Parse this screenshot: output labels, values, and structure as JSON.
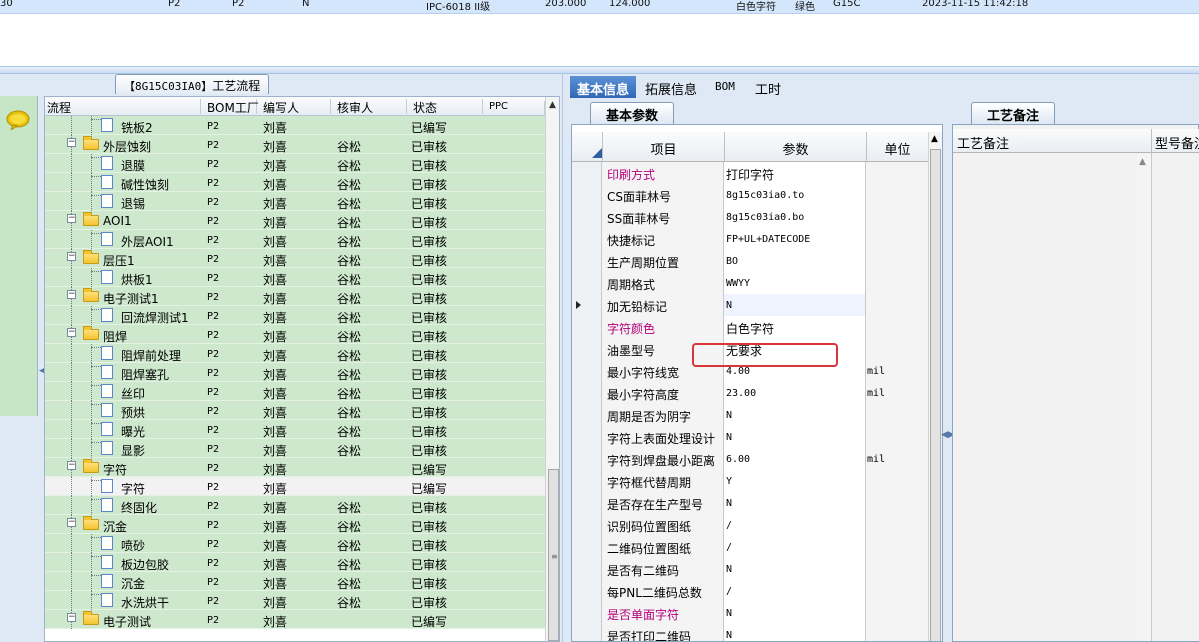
{
  "top_row": [
    "30",
    "P2",
    "P2",
    "N",
    "IPC-6018 II级",
    "203.000",
    "124.000",
    "白色字符",
    "绿色",
    "G15C",
    "2023-11-15 11:42:18"
  ],
  "left_panel": {
    "tab_code": "【8G15C03IA0】",
    "tab_label": "工艺流程",
    "columns": [
      "流程",
      "BOM工厂",
      "编写人",
      "核审人",
      "状态",
      "PPC"
    ]
  },
  "tree_rows": [
    {
      "level": 2,
      "type": "doc",
      "name": "铣板2",
      "bom": "P2",
      "writer": "刘喜",
      "reviewer": "",
      "status": "已编写"
    },
    {
      "level": 1,
      "type": "folder",
      "name": "外层蚀刻",
      "bom": "P2",
      "writer": "刘喜",
      "reviewer": "谷松",
      "status": "已审核"
    },
    {
      "level": 2,
      "type": "doc",
      "name": "退膜",
      "bom": "P2",
      "writer": "刘喜",
      "reviewer": "谷松",
      "status": "已审核"
    },
    {
      "level": 2,
      "type": "doc",
      "name": "碱性蚀刻",
      "bom": "P2",
      "writer": "刘喜",
      "reviewer": "谷松",
      "status": "已审核"
    },
    {
      "level": 2,
      "type": "doc",
      "name": "退锡",
      "bom": "P2",
      "writer": "刘喜",
      "reviewer": "谷松",
      "status": "已审核"
    },
    {
      "level": 1,
      "type": "folder",
      "name": "AOI1",
      "bom": "P2",
      "writer": "刘喜",
      "reviewer": "谷松",
      "status": "已审核"
    },
    {
      "level": 2,
      "type": "doc",
      "name": "外层AOI1",
      "bom": "P2",
      "writer": "刘喜",
      "reviewer": "谷松",
      "status": "已审核"
    },
    {
      "level": 1,
      "type": "folder",
      "name": "层压1",
      "bom": "P2",
      "writer": "刘喜",
      "reviewer": "谷松",
      "status": "已审核"
    },
    {
      "level": 2,
      "type": "doc",
      "name": "烘板1",
      "bom": "P2",
      "writer": "刘喜",
      "reviewer": "谷松",
      "status": "已审核"
    },
    {
      "level": 1,
      "type": "folder",
      "name": "电子测试1",
      "bom": "P2",
      "writer": "刘喜",
      "reviewer": "谷松",
      "status": "已审核"
    },
    {
      "level": 2,
      "type": "doc",
      "name": "回流焊测试1",
      "bom": "P2",
      "writer": "刘喜",
      "reviewer": "谷松",
      "status": "已审核"
    },
    {
      "level": 1,
      "type": "folder",
      "name": "阻焊",
      "bom": "P2",
      "writer": "刘喜",
      "reviewer": "谷松",
      "status": "已审核"
    },
    {
      "level": 2,
      "type": "doc",
      "name": "阻焊前处理",
      "bom": "P2",
      "writer": "刘喜",
      "reviewer": "谷松",
      "status": "已审核"
    },
    {
      "level": 2,
      "type": "doc",
      "name": "阻焊塞孔",
      "bom": "P2",
      "writer": "刘喜",
      "reviewer": "谷松",
      "status": "已审核"
    },
    {
      "level": 2,
      "type": "doc",
      "name": "丝印",
      "bom": "P2",
      "writer": "刘喜",
      "reviewer": "谷松",
      "status": "已审核"
    },
    {
      "level": 2,
      "type": "doc",
      "name": "预烘",
      "bom": "P2",
      "writer": "刘喜",
      "reviewer": "谷松",
      "status": "已审核"
    },
    {
      "level": 2,
      "type": "doc",
      "name": "曝光",
      "bom": "P2",
      "writer": "刘喜",
      "reviewer": "谷松",
      "status": "已审核"
    },
    {
      "level": 2,
      "type": "doc",
      "name": "显影",
      "bom": "P2",
      "writer": "刘喜",
      "reviewer": "谷松",
      "status": "已审核"
    },
    {
      "level": 1,
      "type": "folder",
      "name": "字符",
      "bom": "P2",
      "writer": "刘喜",
      "reviewer": "",
      "status": "已编写"
    },
    {
      "level": 2,
      "type": "doc",
      "name": "字符",
      "bom": "P2",
      "writer": "刘喜",
      "reviewer": "",
      "status": "已编写",
      "selected": true
    },
    {
      "level": 2,
      "type": "doc",
      "name": "终固化",
      "bom": "P2",
      "writer": "刘喜",
      "reviewer": "谷松",
      "status": "已审核"
    },
    {
      "level": 1,
      "type": "folder",
      "name": "沉金",
      "bom": "P2",
      "writer": "刘喜",
      "reviewer": "谷松",
      "status": "已审核"
    },
    {
      "level": 2,
      "type": "doc",
      "name": "喷砂",
      "bom": "P2",
      "writer": "刘喜",
      "reviewer": "谷松",
      "status": "已审核"
    },
    {
      "level": 2,
      "type": "doc",
      "name": "板边包胶",
      "bom": "P2",
      "writer": "刘喜",
      "reviewer": "谷松",
      "status": "已审核"
    },
    {
      "level": 2,
      "type": "doc",
      "name": "沉金",
      "bom": "P2",
      "writer": "刘喜",
      "reviewer": "谷松",
      "status": "已审核"
    },
    {
      "level": 2,
      "type": "doc",
      "name": "水洗烘干",
      "bom": "P2",
      "writer": "刘喜",
      "reviewer": "谷松",
      "status": "已审核"
    },
    {
      "level": 1,
      "type": "folder",
      "name": "电子测试",
      "bom": "P2",
      "writer": "刘喜",
      "reviewer": "",
      "status": "已编写"
    }
  ],
  "main_tabs": [
    {
      "label": "基本信息",
      "active": true
    },
    {
      "label": "拓展信息",
      "active": false
    },
    {
      "label": "BOM",
      "active": false
    },
    {
      "label": "工时",
      "active": false
    }
  ],
  "param_panel": {
    "tab_label": "基本参数",
    "columns": [
      "项目",
      "参数",
      "单位"
    ]
  },
  "param_rows": [
    {
      "name": "印刷方式",
      "value": "打印字符",
      "unit": "",
      "pink": true
    },
    {
      "name": "CS面菲林号",
      "value": "8g15c03ia0.to",
      "unit": "",
      "mono": true
    },
    {
      "name": "SS面菲林号",
      "value": "8g15c03ia0.bo",
      "unit": "",
      "mono": true
    },
    {
      "name": "快捷标记",
      "value": "FP+UL+DATECODE",
      "unit": "",
      "mono": true
    },
    {
      "name": "生产周期位置",
      "value": "BO",
      "unit": "",
      "mono": true
    },
    {
      "name": "周期格式",
      "value": "WWYY",
      "unit": "",
      "mono": true
    },
    {
      "name": "加无铅标记",
      "value": "N",
      "unit": "",
      "mono": true,
      "current": true
    },
    {
      "name": "字符颜色",
      "value": "白色字符",
      "unit": "",
      "pink": true
    },
    {
      "name": "油墨型号",
      "value": "无要求",
      "unit": ""
    },
    {
      "name": "最小字符线宽",
      "value": "4.00",
      "unit": "mil",
      "mono": true
    },
    {
      "name": "最小字符高度",
      "value": "23.00",
      "unit": "mil",
      "mono": true
    },
    {
      "name": "周期是否为阴字",
      "value": "N",
      "unit": "",
      "mono": true
    },
    {
      "name": "字符上表面处理设计",
      "value": "N",
      "unit": "",
      "mono": true
    },
    {
      "name": "字符到焊盘最小距离",
      "value": "6.00",
      "unit": "mil",
      "mono": true
    },
    {
      "name": "字符框代替周期",
      "value": "Y",
      "unit": "",
      "mono": true
    },
    {
      "name": "是否存在生产型号",
      "value": "N",
      "unit": "",
      "mono": true
    },
    {
      "name": "识别码位置图纸",
      "value": "/",
      "unit": "",
      "mono": true
    },
    {
      "name": "二维码位置图纸",
      "value": "/",
      "unit": "",
      "mono": true
    },
    {
      "name": "是否有二维码",
      "value": "N",
      "unit": "",
      "mono": true
    },
    {
      "name": "每PNL二维码总数",
      "value": "/",
      "unit": "",
      "mono": true
    },
    {
      "name": "是否单面字符",
      "value": "N",
      "unit": "",
      "mono": true,
      "pink": true
    },
    {
      "name": "是否打印二维码",
      "value": "N",
      "unit": "",
      "mono": true
    }
  ],
  "notes_panel": {
    "tab_label": "工艺备注",
    "col1": "工艺备注",
    "col2": "型号备注"
  },
  "colors": {
    "row_green": "#cde8cd",
    "active_tab": "#2f67b5",
    "pink_label": "#b4007a",
    "highlight": "#d9353d"
  }
}
